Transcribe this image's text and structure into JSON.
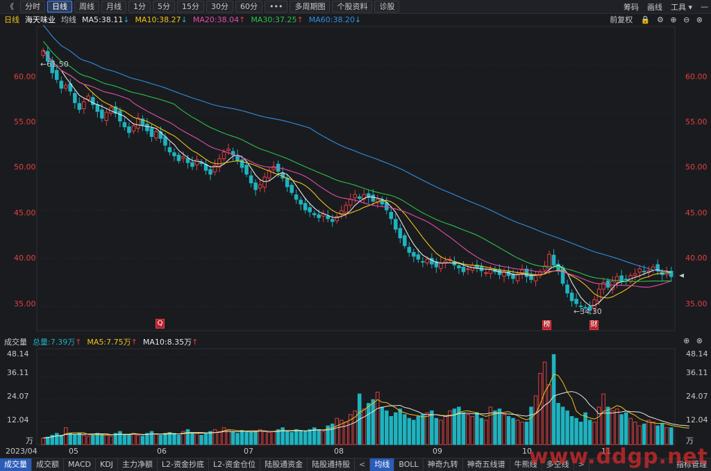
{
  "toolbar": {
    "back": "《",
    "tabs": [
      "分时",
      "日线",
      "周线",
      "月线",
      "1分",
      "5分",
      "15分",
      "30分",
      "60分",
      "•••",
      "多周期图",
      "个股资料",
      "诊股"
    ],
    "active_tab": "日线",
    "right": [
      "筹码",
      "画线",
      "工具"
    ]
  },
  "info": {
    "period": "日线",
    "name": "海天味业",
    "avg_label": "均线",
    "ma5": "MA5:38.11",
    "ma10": "MA10:38.27",
    "ma20": "MA20:38.04",
    "ma30": "MA30:37.25",
    "ma60": "MA60:38.20",
    "adjust": "前复权"
  },
  "volume_info": {
    "label": "成交量",
    "total": "总量:7.39万",
    "ma5": "MA5:7.75万",
    "ma10": "MA10:8.35万"
  },
  "price_axis": [
    "60.00",
    "55.00",
    "50.00",
    "45.00",
    "40.00",
    "35.00"
  ],
  "volume_axis": [
    "48.14",
    "36.11",
    "24.07",
    "12.04",
    "万"
  ],
  "date_labels": [
    "2023/04",
    "05",
    "06",
    "07",
    "08",
    "09",
    "10",
    "11"
  ],
  "annotations": {
    "high": "61.50",
    "low": "34.30"
  },
  "markers": [
    "Q",
    "榜",
    "财"
  ],
  "bottom_left_tabs": [
    "成交量",
    "成交额",
    "MACD",
    "KDJ",
    "主力净额",
    "L2-资金抄底",
    "L2-资金仓位",
    "陆股通资金",
    "陆股通持股"
  ],
  "bottom_right_tabs": [
    "均线",
    "BOLL",
    "神奇九转",
    "神奇五线谱",
    "牛熊线",
    "多空线"
  ],
  "bottom_far_right": "指标管理",
  "watermark": "www.ddgp.net",
  "colors": {
    "up": "#e04040",
    "down": "#1fb3bf",
    "ma5": "#e8e8e8",
    "ma10": "#f0c419",
    "ma20": "#e04fa8",
    "ma30": "#2bc24a",
    "ma60": "#2f8fe0"
  },
  "chart_data": {
    "type": "candlestick",
    "ylim": [
      32.5,
      64
    ],
    "vol_max": 48.14,
    "closes": [
      61.5,
      60.4,
      59.2,
      58.5,
      57.6,
      57.9,
      57.3,
      56.1,
      55.4,
      56.2,
      56.8,
      55.9,
      55.2,
      54.5,
      55.1,
      55.6,
      55.0,
      54.2,
      53.6,
      53.0,
      53.7,
      54.5,
      53.8,
      53.2,
      52.6,
      53.1,
      52.4,
      51.7,
      51.0,
      50.6,
      50.1,
      50.5,
      49.9,
      49.5,
      50.2,
      49.8,
      49.1,
      48.7,
      49.6,
      50.3,
      51.0,
      51.3,
      50.7,
      50.1,
      49.4,
      48.7,
      47.8,
      47.1,
      47.6,
      48.4,
      49.1,
      49.5,
      49.0,
      48.3,
      47.4,
      46.8,
      46.1,
      45.6,
      45.0,
      44.8,
      44.5,
      44.2,
      44.6,
      44.1,
      43.8,
      44.3,
      44.9,
      45.5,
      46.1,
      46.6,
      46.2,
      46.6,
      46.3,
      45.9,
      46.1,
      45.6,
      45.0,
      44.1,
      43.0,
      42.1,
      41.3,
      40.6,
      40.2,
      39.9,
      39.6,
      39.9,
      39.4,
      39.1,
      39.5,
      39.7,
      39.9,
      39.3,
      39.0,
      38.6,
      38.9,
      39.3,
      39.0,
      38.7,
      38.5,
      38.8,
      38.6,
      38.3,
      38.6,
      38.2,
      37.9,
      38.4,
      38.8,
      38.1,
      37.8,
      38.2,
      38.6,
      39.2,
      40.4,
      39.3,
      38.8,
      37.4,
      36.4,
      35.6,
      35.3,
      35.0,
      34.9,
      34.6,
      35.7,
      36.8,
      37.5,
      37.0,
      37.6,
      38.1,
      37.6,
      37.8,
      38.2,
      38.4,
      38.9,
      38.6,
      38.7,
      39.1,
      38.7,
      38.3,
      38.5,
      38.1
    ],
    "volumes": [
      3.5,
      4,
      5,
      6,
      5,
      9,
      6,
      5.5,
      6,
      5,
      4.5,
      5,
      6,
      5.5,
      5,
      4.5,
      6,
      7,
      5,
      5.5,
      6,
      5,
      4.5,
      6,
      7,
      5.5,
      5,
      6,
      6.5,
      6,
      5,
      7,
      8,
      6.5,
      6,
      5,
      6,
      7,
      8,
      7,
      9,
      8,
      7,
      6,
      7.5,
      7,
      6.5,
      7,
      8,
      7,
      6.5,
      7,
      8,
      9,
      7,
      6.5,
      8,
      7.5,
      7,
      8,
      9,
      8,
      7,
      10,
      11,
      14,
      13,
      12,
      16,
      18,
      27,
      19,
      22,
      24,
      28,
      20,
      18,
      15,
      17,
      19,
      16,
      14,
      13,
      15,
      16,
      17,
      18,
      14,
      13,
      15,
      18,
      19,
      20,
      17,
      16,
      15,
      17,
      14,
      13,
      20,
      18,
      19,
      16,
      15,
      14,
      13,
      12,
      12,
      20,
      26,
      38,
      44,
      32,
      48,
      22,
      20,
      18,
      15,
      14,
      12,
      17,
      13,
      12,
      20,
      27,
      20,
      18,
      19,
      16,
      17,
      14,
      12,
      10,
      11,
      13,
      12,
      10,
      11,
      9,
      9,
      10,
      8,
      9,
      8
    ]
  }
}
